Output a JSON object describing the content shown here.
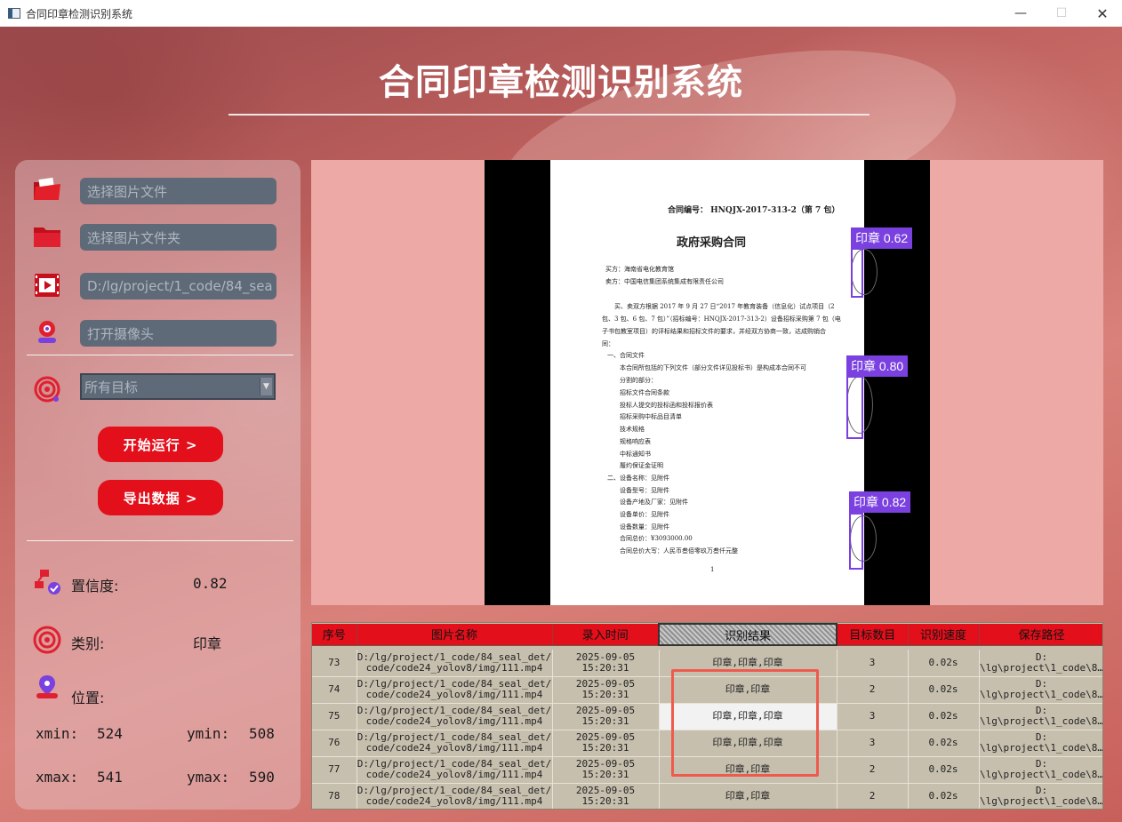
{
  "window": {
    "title": "合同印章检测识别系统"
  },
  "header": {
    "title": "合同印章检测识别系统"
  },
  "inputs": {
    "image_file_placeholder": "选择图片文件",
    "image_folder_placeholder": "选择图片文件夹",
    "video_path": "D:/lg/project/1_code/84_sea",
    "camera_placeholder": "打开摄像头",
    "target_select": "所有目标"
  },
  "buttons": {
    "start": "开始运行 >",
    "export": "导出数据 >"
  },
  "info": {
    "confidence_label": "置信度:",
    "confidence_value": "0.82",
    "class_label": "类别:",
    "class_value": "印章",
    "position_label": "位置:",
    "xmin_label": "xmin:",
    "xmin_value": "524",
    "ymin_label": "ymin:",
    "ymin_value": "508",
    "xmax_label": "xmax:",
    "xmax_value": "541",
    "ymax_label": "ymax:",
    "ymax_value": "590"
  },
  "document": {
    "contract_no": "合同编号： HNQJX-2017-313-2（第 7 包）",
    "title": "政府采购合同",
    "buyer": "买方：海南省电化教育馆",
    "seller": "卖方：中国电信集团系统集成有限责任公司",
    "p1": "买、卖双方根据 2017 年 9 月 27 日“2017 年教育装备（信息化）试点项目（2",
    "p2": "包、3 包、6 包、7 包）”（招标编号：HNQJX-2017-313-2）设备招标采购第 7 包（电",
    "p3": "子书包教室项目）的评标结果和招标文件的要求，并经双方协商一致，达成购销合",
    "p4": "同：",
    "s1": "一、合同文件",
    "s1a": "本合同所包括的下列文件（部分文件详见投标书）是构成本合同不可",
    "s1b": "分割的部分：",
    "items": [
      "招标文件合同条款",
      "投标人提交的投标函和投标报价表",
      "招标采购中标品目清单",
      "技术规格",
      "规格响应表",
      "中标通知书",
      "履约保证金证明"
    ],
    "s2": "二、设备名称：见附件",
    "specs": [
      "设备型号：见附件",
      "设备产地及厂家：见附件",
      "设备单价：见附件",
      "设备数量：见附件",
      "合同总价：¥3093000.00",
      "合同总价大写：人民币叁佰零玖万叁仟元整"
    ],
    "page_no": "1",
    "detections": [
      "印章 0.62",
      "印章 0.80",
      "印章 0.82"
    ]
  },
  "table": {
    "headers": [
      "序号",
      "图片名称",
      "录入时间",
      "识别结果",
      "目标数目",
      "识别速度",
      "保存路径"
    ],
    "rows": [
      {
        "id": "73",
        "name1": "D:/lg/project/1_code/84_seal_det/",
        "name2": "code/code24_yolov8/img/111.mp4",
        "date": "2025-09-05",
        "time": "15:20:31",
        "result": "印章,印章,印章",
        "count": "3",
        "speed": "0.02s",
        "path1": "D:",
        "path2": "\\lg\\project\\1_code\\8…"
      },
      {
        "id": "74",
        "name1": "D:/lg/project/1_code/84_seal_det/",
        "name2": "code/code24_yolov8/img/111.mp4",
        "date": "2025-09-05",
        "time": "15:20:31",
        "result": "印章,印章",
        "count": "2",
        "speed": "0.02s",
        "path1": "D:",
        "path2": "\\lg\\project\\1_code\\8…"
      },
      {
        "id": "75",
        "name1": "D:/lg/project/1_code/84_seal_det/",
        "name2": "code/code24_yolov8/img/111.mp4",
        "date": "2025-09-05",
        "time": "15:20:31",
        "result": "印章,印章,印章",
        "count": "3",
        "speed": "0.02s",
        "path1": "D:",
        "path2": "\\lg\\project\\1_code\\8…"
      },
      {
        "id": "76",
        "name1": "D:/lg/project/1_code/84_seal_det/",
        "name2": "code/code24_yolov8/img/111.mp4",
        "date": "2025-09-05",
        "time": "15:20:31",
        "result": "印章,印章,印章",
        "count": "3",
        "speed": "0.02s",
        "path1": "D:",
        "path2": "\\lg\\project\\1_code\\8…"
      },
      {
        "id": "77",
        "name1": "D:/lg/project/1_code/84_seal_det/",
        "name2": "code/code24_yolov8/img/111.mp4",
        "date": "2025-09-05",
        "time": "15:20:31",
        "result": "印章,印章",
        "count": "2",
        "speed": "0.02s",
        "path1": "D:",
        "path2": "\\lg\\project\\1_code\\8…"
      },
      {
        "id": "78",
        "name1": "D:/lg/project/1_code/84_seal_det/",
        "name2": "code/code24_yolov8/img/111.mp4",
        "date": "2025-09-05",
        "time": "15:20:31",
        "result": "印章,印章",
        "count": "2",
        "speed": "0.02s",
        "path1": "D:",
        "path2": "\\lg\\project\\1_code\\8…"
      }
    ]
  },
  "colors": {
    "accent_red": "#e30f1b",
    "detection_purple": "#7a40e0",
    "table_bg": "#c6bfae"
  },
  "icons": [
    "folder-open-icon",
    "folder-icon",
    "video-icon",
    "camera-icon",
    "target-icon",
    "confidence-icon",
    "class-icon",
    "location-icon"
  ]
}
